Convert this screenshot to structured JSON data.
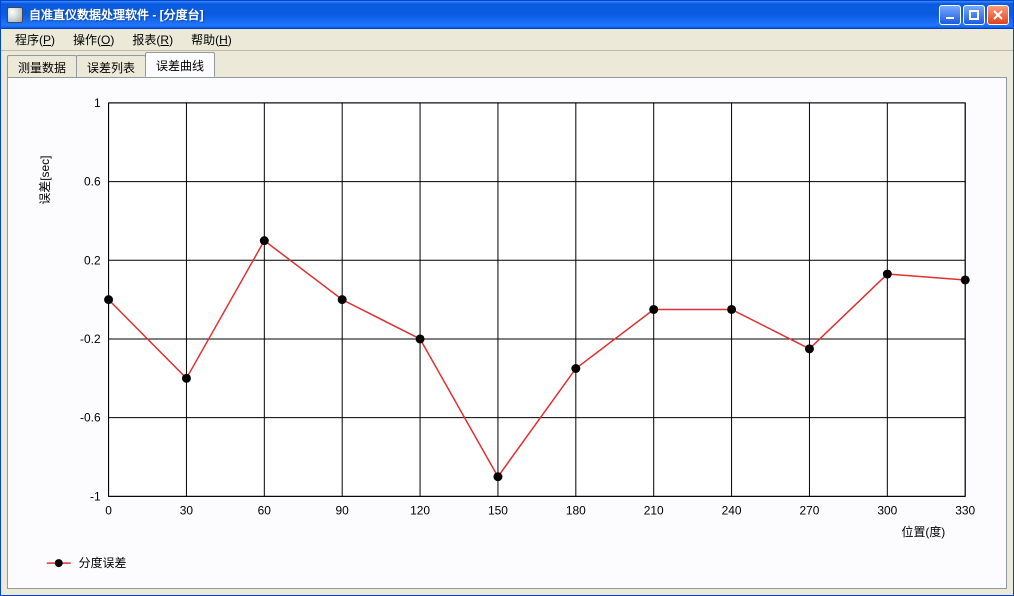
{
  "window": {
    "title": "自准直仪数据处理软件 - [分度台]"
  },
  "menu": {
    "program": {
      "label": "程序",
      "accel": "P"
    },
    "operate": {
      "label": "操作",
      "accel": "O"
    },
    "report": {
      "label": "报表",
      "accel": "R"
    },
    "help": {
      "label": "帮助",
      "accel": "H"
    }
  },
  "tabs": {
    "measure_data": "测量数据",
    "error_list": "误差列表",
    "error_curve": "误差曲线"
  },
  "chart": {
    "ylabel": "误差[sec]",
    "xlabel": "位置(度)",
    "legend_name": "分度误差",
    "x_ticks": [
      "0",
      "30",
      "60",
      "90",
      "120",
      "150",
      "180",
      "210",
      "240",
      "270",
      "300",
      "330"
    ],
    "y_ticks": [
      "-1",
      "-0.6",
      "-0.2",
      "0.2",
      "0.6",
      "1"
    ]
  },
  "chart_data": {
    "type": "line",
    "title": "",
    "xlabel": "位置(度)",
    "ylabel": "误差[sec]",
    "series": [
      {
        "name": "分度误差",
        "x": [
          0,
          30,
          60,
          90,
          120,
          150,
          180,
          210,
          240,
          270,
          300,
          330
        ],
        "y": [
          0.0,
          -0.4,
          0.3,
          0.0,
          -0.2,
          -0.9,
          -0.35,
          -0.05,
          -0.05,
          -0.25,
          0.13,
          0.1
        ]
      }
    ],
    "xlim": [
      0,
      330
    ],
    "ylim": [
      -1,
      1
    ]
  }
}
